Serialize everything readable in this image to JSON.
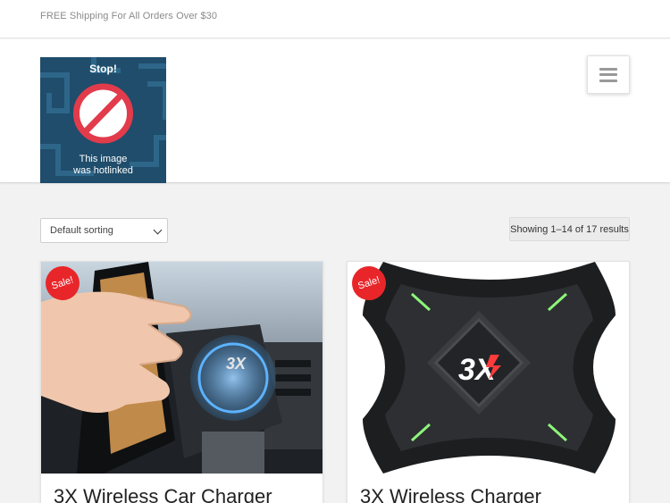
{
  "topbar": {
    "promo": "FREE Shipping For All Orders Over $30"
  },
  "logo": {
    "line1": "Stop!",
    "line2": "This image",
    "line3": "was hotlinked"
  },
  "shop": {
    "sorting": "Default sorting",
    "results": "Showing 1–14 of 17 results"
  },
  "products": [
    {
      "title": "3X Wireless Car Charger",
      "badge": "Sale!"
    },
    {
      "title": "3X Wireless Charger",
      "badge": "Sale!"
    }
  ],
  "icons": {
    "menu": "hamburger-icon",
    "sort": "chevron-down-icon"
  },
  "colors": {
    "sale": "#e8262a",
    "logo_bg": "#1f4d6b",
    "accent": "#ff3b3b"
  },
  "charger_brand": "3X"
}
